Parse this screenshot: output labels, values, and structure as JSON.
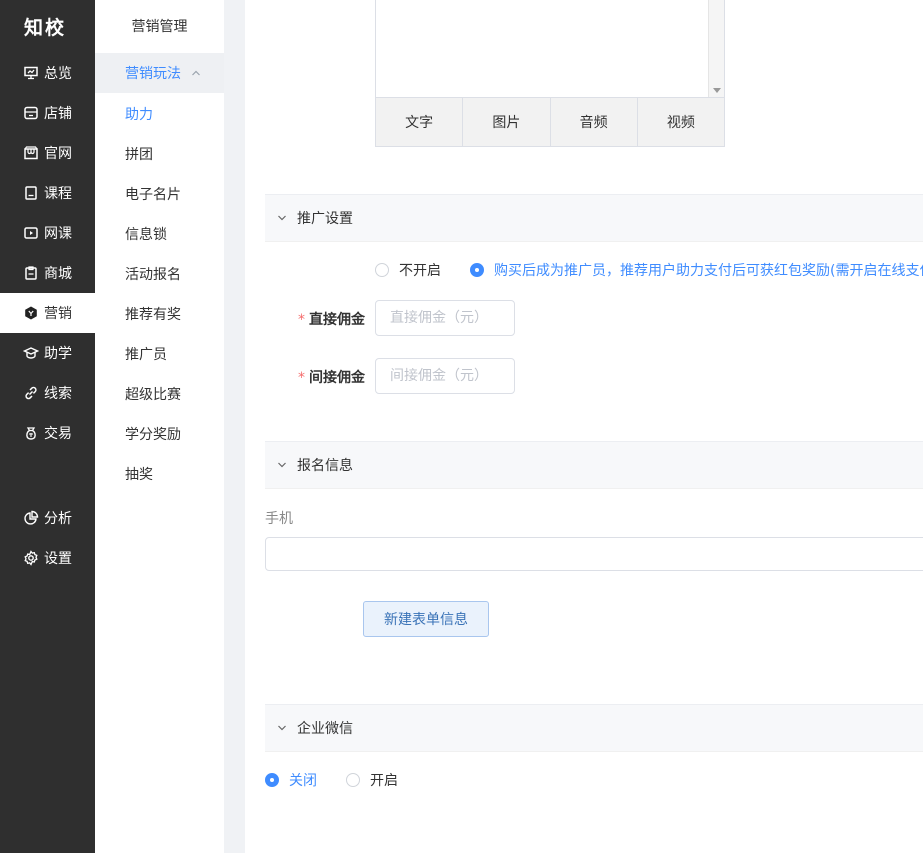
{
  "brand": {
    "logo": "知校"
  },
  "nav": {
    "items": [
      {
        "label": "总览",
        "icon": "dashboard-icon"
      },
      {
        "label": "店铺",
        "icon": "store-icon"
      },
      {
        "label": "官网",
        "icon": "website-icon"
      },
      {
        "label": "课程",
        "icon": "course-icon"
      },
      {
        "label": "网课",
        "icon": "video-course-icon"
      },
      {
        "label": "商城",
        "icon": "mall-icon"
      },
      {
        "label": "营销",
        "icon": "marketing-icon"
      },
      {
        "label": "助学",
        "icon": "study-icon"
      },
      {
        "label": "线索",
        "icon": "leads-icon"
      },
      {
        "label": "交易",
        "icon": "trade-icon"
      },
      {
        "label": "分析",
        "icon": "analysis-icon"
      },
      {
        "label": "设置",
        "icon": "settings-icon"
      }
    ],
    "active": "营销"
  },
  "submenu": {
    "title": "营销管理",
    "group": "营销玩法",
    "items": [
      "助力",
      "拼团",
      "电子名片",
      "信息锁",
      "活动报名",
      "推荐有奖",
      "推广员",
      "超级比赛",
      "学分奖励",
      "抽奖"
    ],
    "current": "助力"
  },
  "editor": {
    "tools": [
      "文字",
      "图片",
      "音频",
      "视频"
    ]
  },
  "promotion": {
    "title": "推广设置",
    "option_off": "不开启",
    "option_on": "购买后成为推广员，推荐用户助力支付后可获红包奖励(需开启在线支付",
    "selected": "option_on",
    "direct_label": "直接佣金",
    "direct_placeholder": "直接佣金（元）",
    "indirect_label": "间接佣金",
    "indirect_placeholder": "间接佣金（元）",
    "required_mark": "*"
  },
  "signup": {
    "title": "报名信息",
    "phone_label": "手机",
    "phone_value": "",
    "new_button": "新建表单信息"
  },
  "wecom": {
    "title": "企业微信",
    "option_off": "关闭",
    "option_on": "开启",
    "selected": "option_off"
  },
  "colors": {
    "accent": "#3f8cff",
    "sidebar_bg": "#2f2f2f",
    "required": "#f56c6c"
  }
}
